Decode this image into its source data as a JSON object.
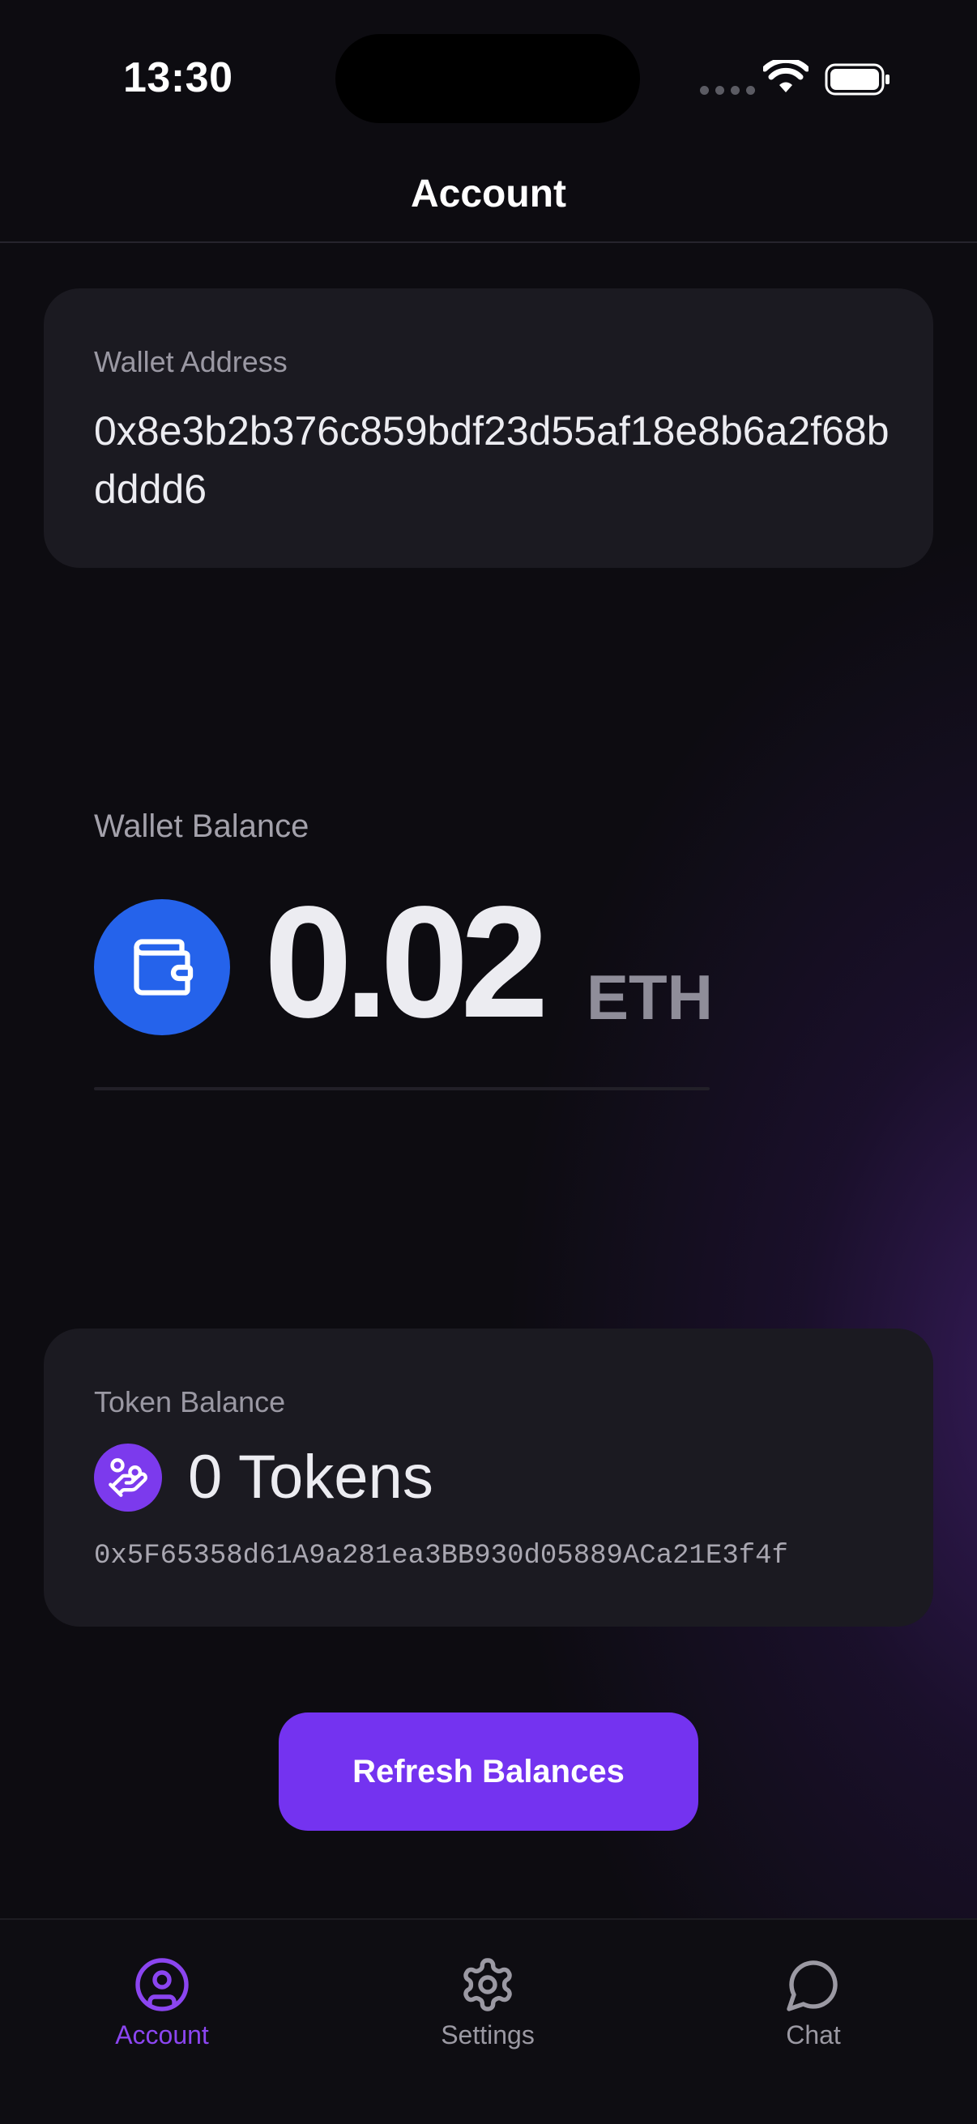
{
  "status_bar": {
    "time": "13:30"
  },
  "header": {
    "title": "Account"
  },
  "address_card": {
    "label": "Wallet Address",
    "value": "0x8e3b2b376c859bdf23d55af18e8b6a2f68bdddd6"
  },
  "balance": {
    "label": "Wallet Balance",
    "value": "0.02",
    "unit": "ETH",
    "icon": "wallet-icon"
  },
  "token_card": {
    "label": "Token Balance",
    "value": "0 Tokens",
    "contract": "0x5F65358d61A9a281ea3BB930d05889ACa21E3f4f",
    "icon": "hand-coins-icon"
  },
  "actions": {
    "refresh_label": "Refresh Balances"
  },
  "tabs": [
    {
      "label": "Account",
      "icon": "user-circle-icon",
      "active": true
    },
    {
      "label": "Settings",
      "icon": "gear-icon",
      "active": false
    },
    {
      "label": "Chat",
      "icon": "chat-bubble-icon",
      "active": false
    }
  ],
  "colors": {
    "accent": "#7433f0",
    "wallet_badge": "#2563eb",
    "token_badge": "#7c3aed",
    "active_tab": "#8b45f0",
    "background": "#0d0c11",
    "card": "#1b1a21"
  }
}
